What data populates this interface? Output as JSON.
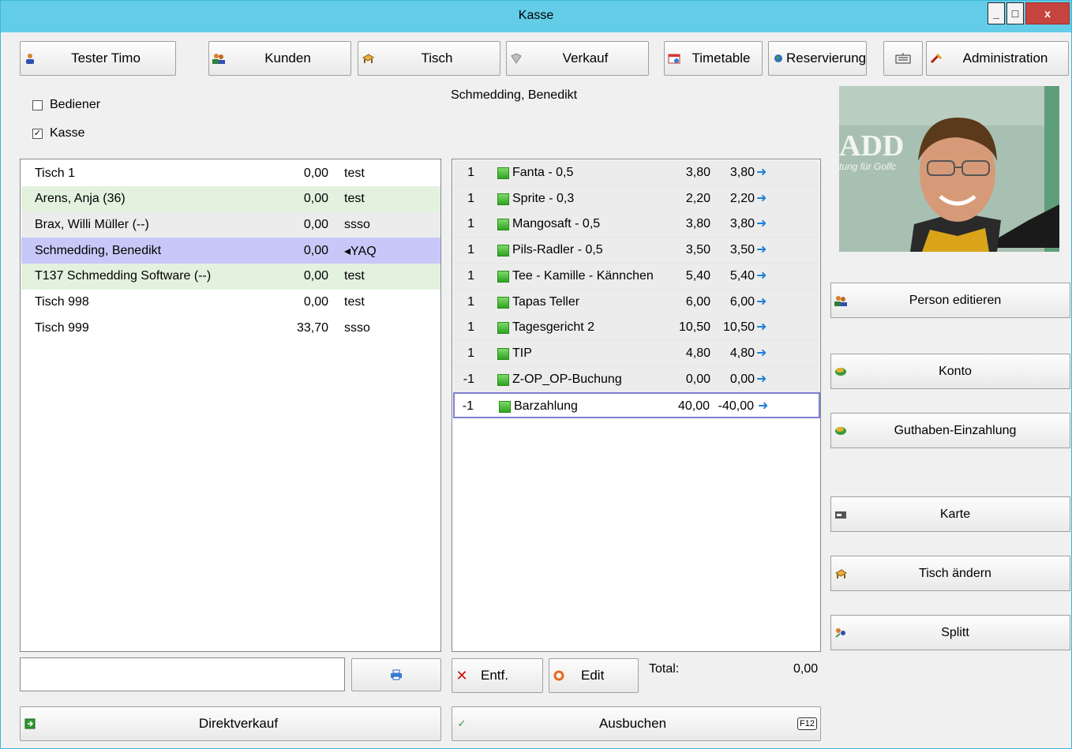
{
  "window": {
    "title": "Kasse",
    "min_label": "_",
    "max_label": "□",
    "close_label": "x"
  },
  "toolbar": {
    "tester": "Tester Timo",
    "kunden": "Kunden",
    "tisch": "Tisch",
    "verkauf": "Verkauf",
    "timetable": "Timetable",
    "reservierung": "Reservierung",
    "administration": "Administration"
  },
  "filters": {
    "bediener": {
      "label": "Bediener",
      "checked": false
    },
    "kasse": {
      "label": "Kasse",
      "checked": true
    }
  },
  "selected_person": "Schmedding, Benedikt",
  "table_list": [
    {
      "name": "Tisch   1",
      "amount": "0,00",
      "code": "test"
    },
    {
      "name": "Arens, Anja (36)",
      "amount": "0,00",
      "code": "test"
    },
    {
      "name": "Brax, Willi Müller (--)",
      "amount": "0,00",
      "code": "ssso"
    },
    {
      "name": "Schmedding, Benedikt",
      "amount": "0,00",
      "code": "◂YAQ"
    },
    {
      "name": "T137 Schmedding Software (--)",
      "amount": "0,00",
      "code": "test"
    },
    {
      "name": "Tisch 998",
      "amount": "0,00",
      "code": "test"
    },
    {
      "name": "Tisch 999",
      "amount": "33,70",
      "code": "ssso"
    }
  ],
  "items": [
    {
      "qty": "1",
      "name": "Fanta - 0,5",
      "price": "3,80",
      "total": "3,80"
    },
    {
      "qty": "1",
      "name": "Sprite - 0,3",
      "price": "2,20",
      "total": "2,20"
    },
    {
      "qty": "1",
      "name": "Mangosaft - 0,5",
      "price": "3,80",
      "total": "3,80"
    },
    {
      "qty": "1",
      "name": "Pils-Radler - 0,5",
      "price": "3,50",
      "total": "3,50"
    },
    {
      "qty": "1",
      "name": "Tee - Kamille - Kännchen",
      "price": "5,40",
      "total": "5,40"
    },
    {
      "qty": "1",
      "name": "Tapas Teller",
      "price": "6,00",
      "total": "6,00"
    },
    {
      "qty": "1",
      "name": "Tagesgericht 2",
      "price": "10,50",
      "total": "10,50"
    },
    {
      "qty": "1",
      "name": "TIP",
      "price": "4,80",
      "total": "4,80"
    },
    {
      "qty": "-1",
      "name": "Z-OP_OP-Buchung",
      "price": "0,00",
      "total": "0,00"
    },
    {
      "qty": "-1",
      "name": "Barzahlung",
      "price": "40,00",
      "total": "-40,00"
    }
  ],
  "actions": {
    "entf": "Entf.",
    "edit": "Edit",
    "total_label": "Total:",
    "total_value": "0,00",
    "direktverkauf": "Direktverkauf",
    "ausbuchen": "Ausbuchen",
    "f12": "F12"
  },
  "side_buttons": {
    "person_edit": "Person editieren",
    "konto": "Konto",
    "guthaben": "Guthaben-Einzahlung",
    "karte": "Karte",
    "tisch_aendern": "Tisch ändern",
    "splitt": "Splitt"
  },
  "photo_text": {
    "big": "ADD",
    "small": "tung für Golfc"
  },
  "colors": {
    "titlebar": "#63cde8",
    "row_green": "#e3f2df",
    "row_selected": "#c8c8f8",
    "row_gray": "#ececec",
    "arrow": "#1f7fd8"
  }
}
